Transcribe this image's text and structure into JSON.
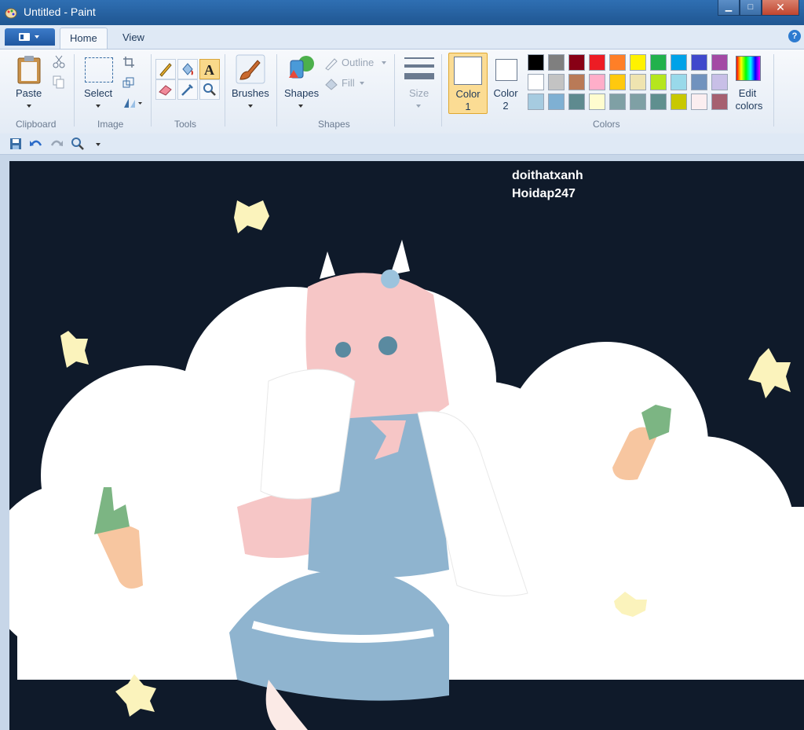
{
  "window": {
    "title": "Untitled - Paint"
  },
  "tabs": [
    "Home",
    "View"
  ],
  "clipboard": {
    "paste_label": "Paste",
    "group_label": "Clipboard"
  },
  "image": {
    "select_label": "Select",
    "group_label": "Image"
  },
  "tools": {
    "group_label": "Tools"
  },
  "brushes": {
    "label": "Brushes"
  },
  "shapes": {
    "shapes_label": "Shapes",
    "outline_label": "Outline",
    "fill_label": "Fill",
    "group_label": "Shapes"
  },
  "size": {
    "label": "Size"
  },
  "colors": {
    "color1_line1": "Color",
    "color1_line2": "1",
    "color2_line1": "Color",
    "color2_line2": "2",
    "edit_line1": "Edit",
    "edit_line2": "colors",
    "group_label": "Colors",
    "palette": [
      [
        "#000000",
        "#7f7f7f",
        "#880015",
        "#ed1c24",
        "#ff7f27",
        "#fff200",
        "#22b14c",
        "#00a2e8",
        "#3f48cc",
        "#a349a4"
      ],
      [
        "#ffffff",
        "#c3c3c3",
        "#b97a57",
        "#ffaec9",
        "#ffc90e",
        "#efe4b0",
        "#b5e61d",
        "#99d9ea",
        "#7092be",
        "#c8bfe7"
      ],
      [
        "#a6cbe0",
        "#7fb0d3",
        "#5e8a8f",
        "#fffccf",
        "#7fa0a5",
        "#7fa0a5",
        "#5f8f8f",
        "#c8c800",
        "#fbeef0",
        "#a66070"
      ]
    ]
  },
  "canvas": {
    "watermark_line1": "doithatxanh",
    "watermark_line2": "Hoidap247",
    "background": "#0f1a2a"
  }
}
